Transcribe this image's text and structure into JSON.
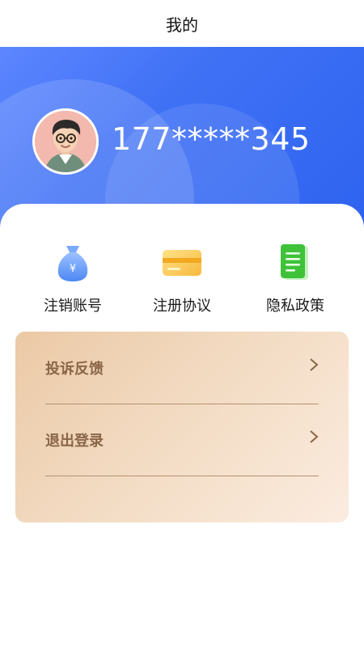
{
  "header": {
    "title": "我的"
  },
  "profile": {
    "phone": "177*****345",
    "avatar_icon": "cartoon-boy-avatar-icon"
  },
  "quick_actions": [
    {
      "label": "注销账号",
      "icon": "money-bag-icon"
    },
    {
      "label": "注册协议",
      "icon": "card-icon"
    },
    {
      "label": "隐私政策",
      "icon": "document-icon"
    }
  ],
  "menu": [
    {
      "label": "投诉反馈",
      "icon": "chevron-right-icon"
    },
    {
      "label": "退出登录",
      "icon": "chevron-right-icon"
    }
  ],
  "colors": {
    "hero": "#3f71f5",
    "card_start": "#ebc9a6",
    "card_end": "#fbece0",
    "menu_text": "#8a6648"
  }
}
